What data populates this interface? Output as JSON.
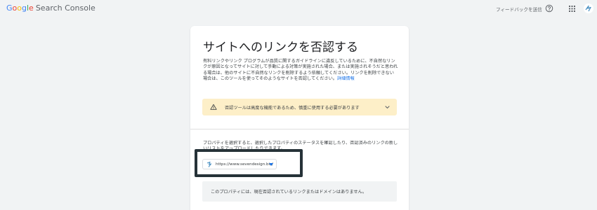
{
  "header": {
    "logo": {
      "google": [
        "G",
        "o",
        "o",
        "g",
        "l",
        "e"
      ],
      "product": "Search Console"
    },
    "feedback_label": "フィードバックを送信",
    "help_icon": "help-circle-icon",
    "apps_icon": "apps-grid-icon",
    "avatar_icon": "account-avatar-icon"
  },
  "page": {
    "title": "サイトへのリンクを否認する",
    "description": "有料リンクやリンク プログラムが品質に関するガイドラインに違反しているために、不自然なリンクが原因となってサイトに対して手動による対策が実施された場合、または実施されそうだと思われる場合は、他のサイトに不自然なリンクを削除するよう依頼してください。リンクを削除できない場合は、このツールを使ってそのようなサイトを否認してください。",
    "details_link": "詳細情報",
    "warning": {
      "icon": "warning-triangle-icon",
      "text": "否認ツールは高度な機能であるため、慎重に使用する必要があります",
      "expand_icon": "chevron-down-icon"
    },
    "property_instruction": "プロパティを選択すると、選択したプロパティのステータスを確認したり、否認済みのリンクの新しいリストをアップロードしたりできます。",
    "property_selector": {
      "favicon": "site-favicon-icon",
      "value": "https://www.sevendesign.biz/",
      "dropdown_icon": "dropdown-triangle-icon"
    },
    "empty_state": "このプロパティには、現在否認されているリンクまたはドメインはありません。"
  },
  "colors": {
    "background": "#f1f3f4",
    "card": "#ffffff",
    "warning_bg": "#fdefc8",
    "link": "#1a73e8",
    "highlight_frame": "#263238"
  }
}
